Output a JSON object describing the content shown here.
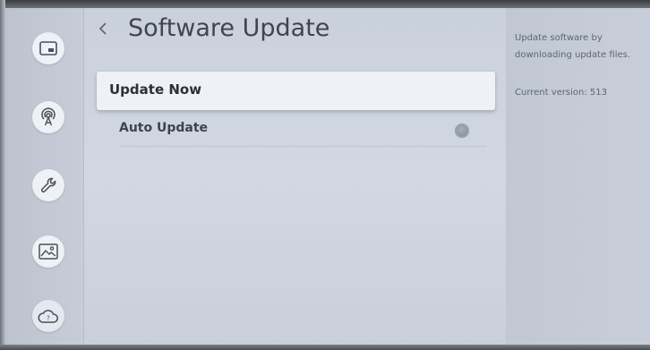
{
  "header": {
    "title": "Software Update",
    "back_icon": "chevron-left-icon"
  },
  "sidebar": {
    "items": [
      {
        "icon": "picture-in-picture-icon"
      },
      {
        "icon": "broadcast-antenna-icon"
      },
      {
        "icon": "wrench-icon"
      },
      {
        "icon": "image-icon"
      },
      {
        "icon": "cloud-support-icon"
      }
    ]
  },
  "menu": {
    "items": [
      {
        "label": "Update Now",
        "focused": true
      },
      {
        "label": "Auto Update",
        "toggle": false
      }
    ]
  },
  "info": {
    "description": "Update software by downloading update files.",
    "version": "Current version: 513"
  },
  "colors": {
    "background": "#cfd5df",
    "focus_bg": "#eef1f5",
    "text_dark": "#2c3038",
    "text_muted": "#5e6573"
  }
}
